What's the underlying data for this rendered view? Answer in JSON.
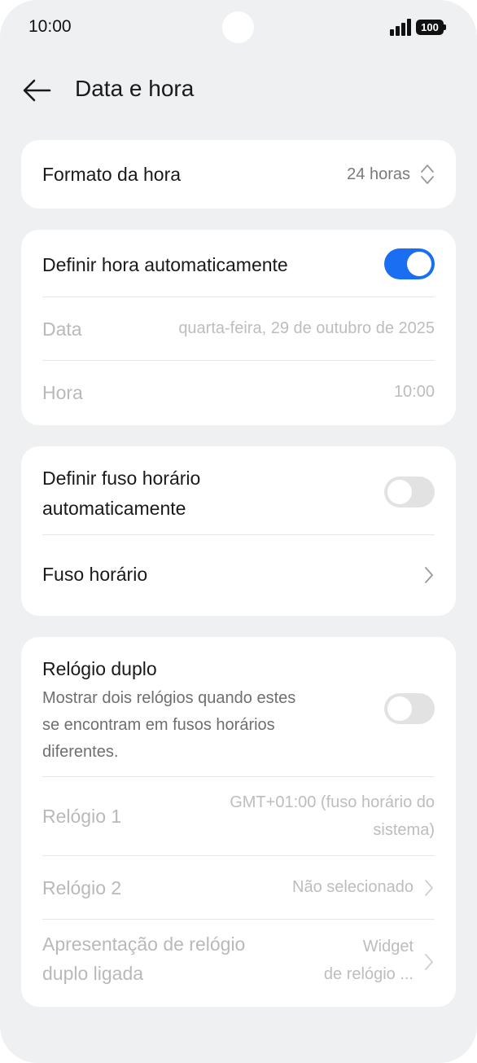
{
  "status_bar": {
    "time": "10:00",
    "battery": "100",
    "icons": [
      "signal-icon",
      "battery-icon"
    ]
  },
  "header": {
    "back_icon": "arrow-left-icon",
    "title": "Data e hora"
  },
  "time_format": {
    "label": "Formato da hora",
    "value": "24 horas",
    "icon": "up-down-chevron-icon"
  },
  "auto_time": {
    "label": "Definir hora automaticamente",
    "enabled": true,
    "date_label": "Data",
    "date_value": "quarta-feira, 29 de outubro de 2025",
    "time_label": "Hora",
    "time_value": "10:00"
  },
  "timezone": {
    "auto_label_line1": "Definir fuso horário",
    "auto_label_line2": "automaticamente",
    "auto_enabled": false,
    "zone_label": "Fuso horário",
    "zone_icon": "chevron-right-icon"
  },
  "dual_clock": {
    "title": "Relógio duplo",
    "desc_line1": "Mostrar dois relógios quando estes",
    "desc_line2": "se encontram em fusos horários",
    "desc_line3": "diferentes.",
    "enabled": false,
    "clock1_label": "Relógio 1",
    "clock1_value_line1": "GMT+01:00 (fuso horário do",
    "clock1_value_line2": "sistema)",
    "clock2_label": "Relógio 2",
    "clock2_value": "Não selecionado",
    "display_label_line1": "Apresentação de relógio",
    "display_label_line2": "duplo ligada",
    "display_value_line1": "Widget",
    "display_value_line2": "de relógio ..."
  },
  "colors": {
    "background": "#eff0f2",
    "card": "#ffffff",
    "accent": "#1a6ef2",
    "disabled_text": "#b9b9b9"
  }
}
